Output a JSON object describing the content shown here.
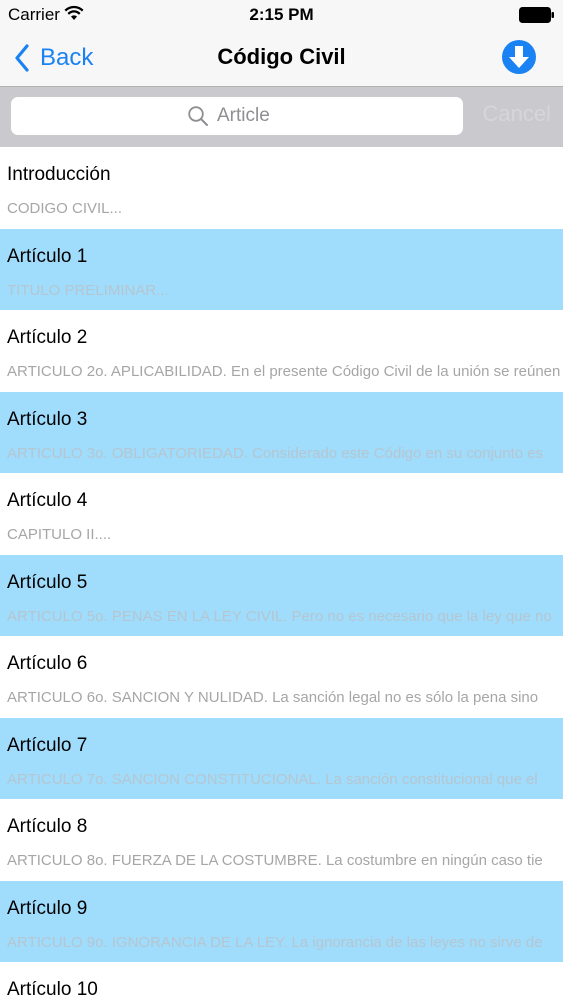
{
  "status_bar": {
    "carrier": "Carrier",
    "time": "2:15 PM"
  },
  "nav": {
    "back_label": "Back",
    "title": "Código Civil",
    "accent_color": "#1a82f2"
  },
  "search": {
    "placeholder": "Article",
    "cancel_label": "Cancel"
  },
  "articles": [
    {
      "title": "Introducción",
      "subtitle": "CODIGO CIVIL..."
    },
    {
      "title": "Artículo 1",
      "subtitle": "TITULO PRELIMINAR..."
    },
    {
      "title": "Artículo 2",
      "subtitle": "ARTICULO 2o. APLICABILIDAD. En el presente Código Civil de la unión se reúnen"
    },
    {
      "title": "Artículo 3",
      "subtitle": "ARTICULO 3o. OBLIGATORIEDAD. Considerado este Código en su conjunto es"
    },
    {
      "title": "Artículo 4",
      "subtitle": "CAPITULO II...."
    },
    {
      "title": "Artículo 5",
      "subtitle": "ARTICULO 5o. PENAS EN LA LEY CIVIL. Pero no es necesario que la ley que no"
    },
    {
      "title": "Artículo 6",
      "subtitle": "ARTICULO 6o. SANCION Y NULIDAD. La sanción legal no es sólo la pena sino"
    },
    {
      "title": "Artículo 7",
      "subtitle": "ARTICULO 7o. SANCION CONSTITUCIONAL. La sanción constitucional que el"
    },
    {
      "title": "Artículo 8",
      "subtitle": "ARTICULO 8o. FUERZA DE LA COSTUMBRE. La costumbre en ningún caso tie"
    },
    {
      "title": "Artículo 9",
      "subtitle": "ARTICULO 9o. IGNORANCIA DE LA LEY. La ignorancia de las leyes no sirve de"
    },
    {
      "title": "Artículo 10",
      "subtitle": ""
    }
  ],
  "colors": {
    "row_alt": "#a0dcfc",
    "row_default": "#ffffff",
    "search_bar_bg": "#c9c9ce"
  },
  "icons": {
    "wifi": "wifi-icon",
    "battery": "battery-icon",
    "back": "chevron-left-icon",
    "download": "download-icon",
    "search": "search-icon"
  }
}
